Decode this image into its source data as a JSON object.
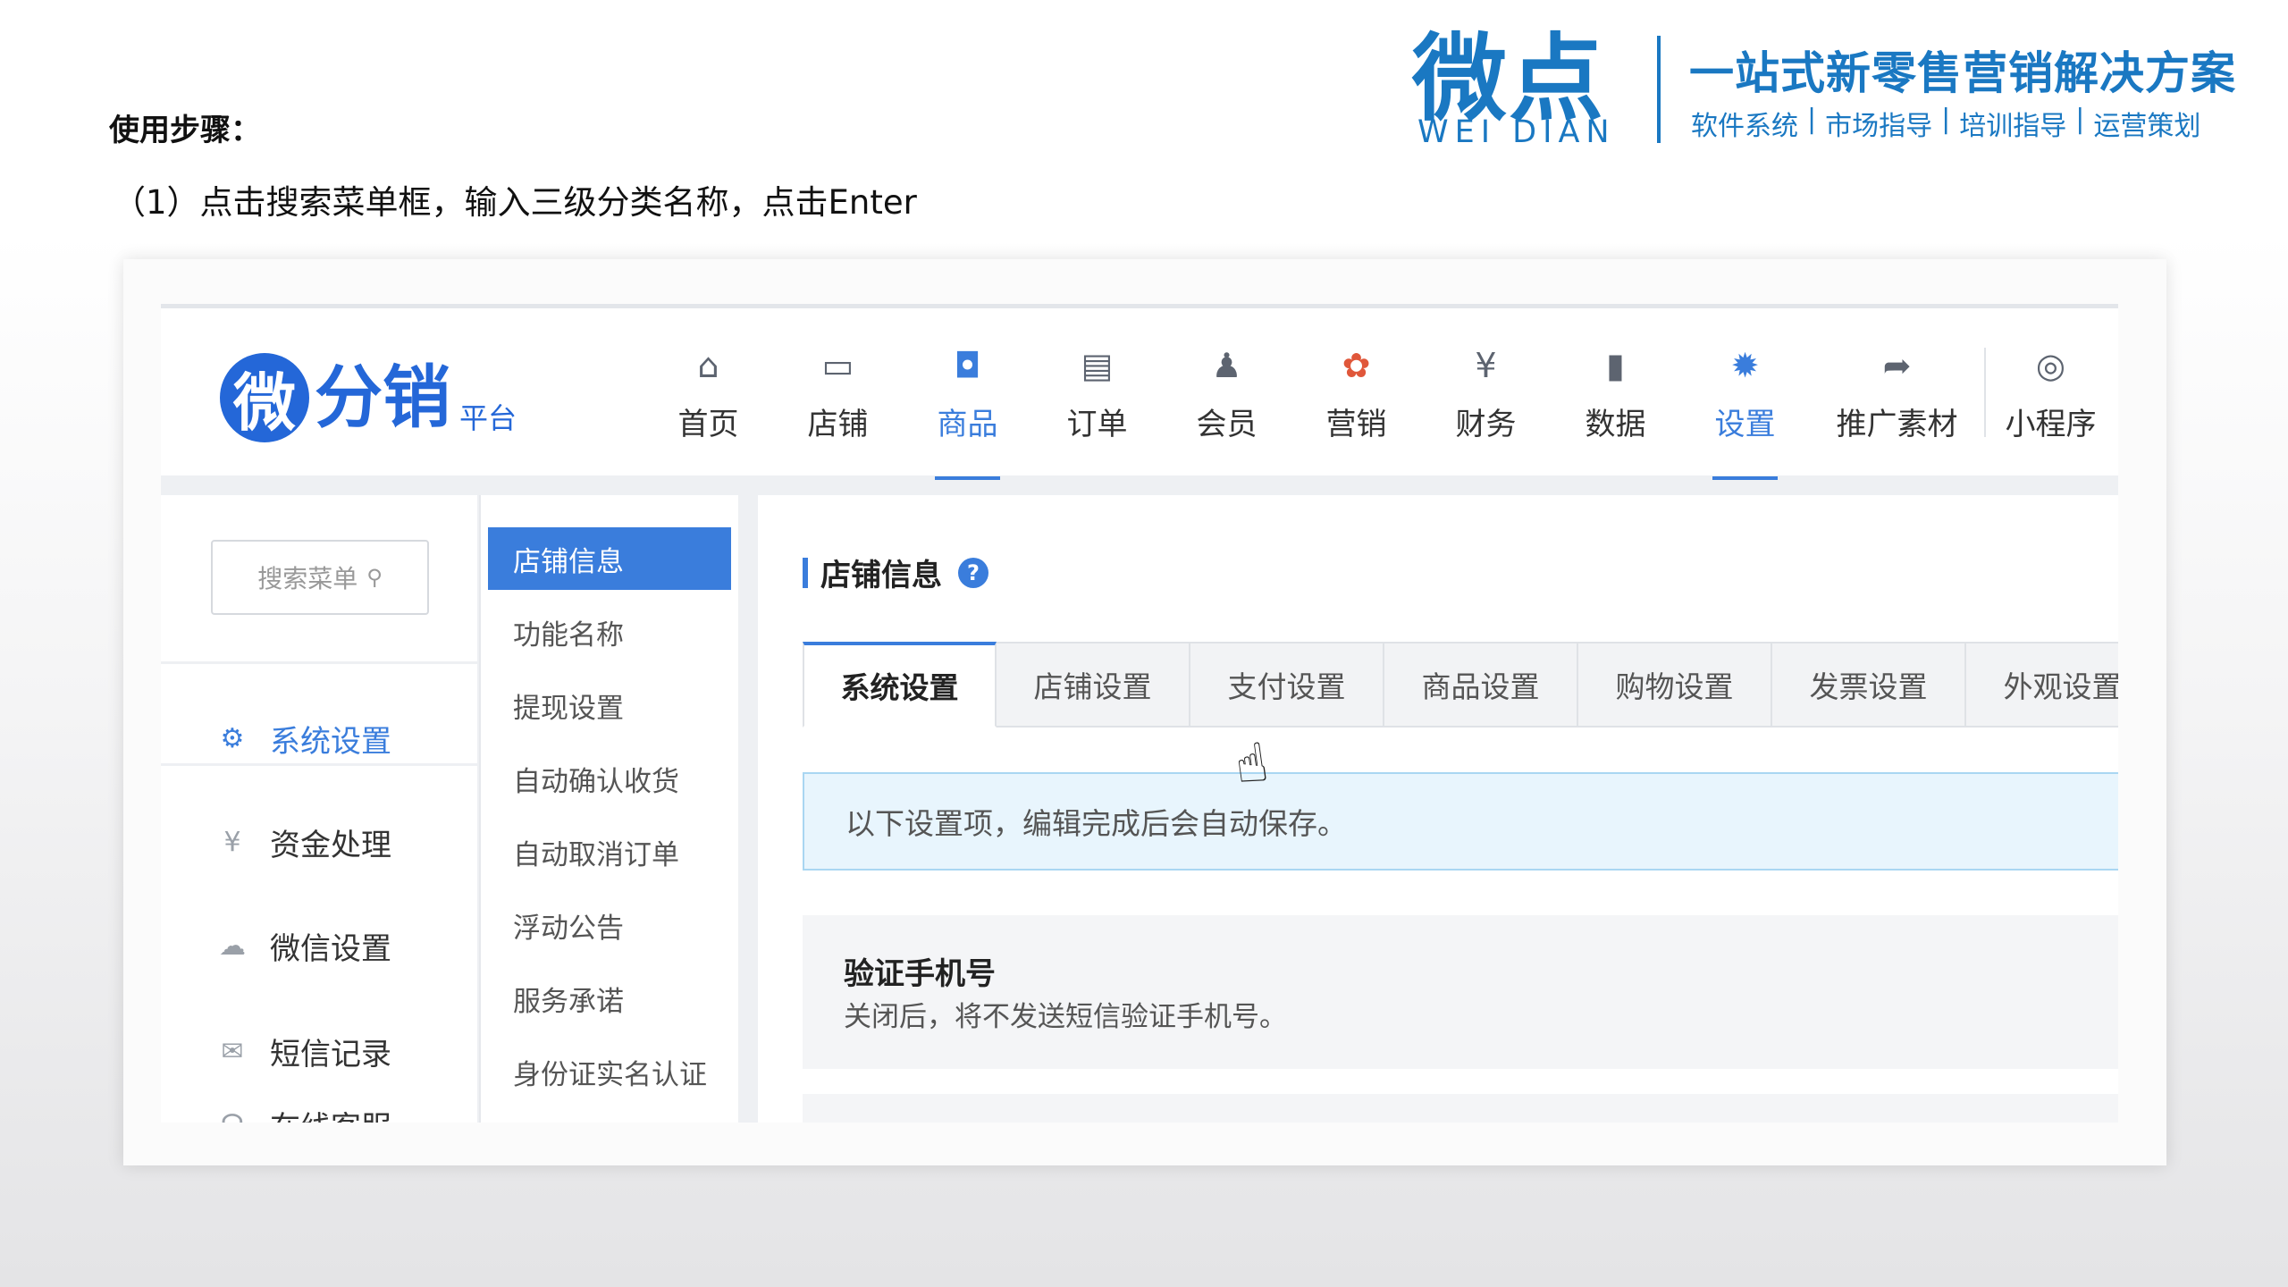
{
  "slide": {
    "steps_title": "使用步骤：",
    "step_1": "（1）点击搜索菜单框，输入三级分类名称，点击Enter"
  },
  "brand": {
    "logo_text": "微点",
    "pinyin": "WEI DIAN",
    "slogan": "一站式新零售营销解决方案",
    "services": [
      "软件系统",
      "市场指导",
      "培训指导",
      "运营策划"
    ]
  },
  "app": {
    "logo": {
      "badge": "微",
      "name": "分销",
      "sub": "平台"
    },
    "nav": [
      {
        "label": "首页",
        "icon": "home-icon",
        "glyph": "⌂"
      },
      {
        "label": "店铺",
        "icon": "store-icon",
        "glyph": "▭"
      },
      {
        "label": "商品",
        "icon": "product-icon",
        "glyph": "◘",
        "active": true
      },
      {
        "label": "订单",
        "icon": "order-icon",
        "glyph": "▤"
      },
      {
        "label": "会员",
        "icon": "member-icon",
        "glyph": "♟"
      },
      {
        "label": "营销",
        "icon": "marketing-icon",
        "glyph": "✿"
      },
      {
        "label": "财务",
        "icon": "finance-icon",
        "glyph": "¥"
      },
      {
        "label": "数据",
        "icon": "data-icon",
        "glyph": "▮"
      },
      {
        "label": "设置",
        "icon": "settings-icon",
        "glyph": "✹",
        "active": true
      },
      {
        "label": "推广素材",
        "icon": "share-icon",
        "glyph": "➦"
      },
      {
        "label": "小程序",
        "icon": "mini-program-icon",
        "glyph": "◎"
      }
    ],
    "sidebar": {
      "search_placeholder": "搜索菜单",
      "items": [
        {
          "label": "系统设置",
          "icon": "gear-icon",
          "glyph": "⚙",
          "active": true
        },
        {
          "label": "资金处理",
          "icon": "yen-icon",
          "glyph": "¥"
        },
        {
          "label": "微信设置",
          "icon": "wechat-icon",
          "glyph": "☁"
        },
        {
          "label": "短信记录",
          "icon": "mail-icon",
          "glyph": "✉"
        },
        {
          "label": "在线客服",
          "icon": "headset-icon",
          "glyph": "☊"
        }
      ]
    },
    "subnav": [
      "店铺信息",
      "功能名称",
      "提现设置",
      "自动确认收货",
      "自动取消订单",
      "浮动公告",
      "服务承诺",
      "身份证实名认证"
    ],
    "content": {
      "title": "店铺信息",
      "help": "?",
      "tabs": [
        "系统设置",
        "店铺设置",
        "支付设置",
        "商品设置",
        "购物设置",
        "发票设置",
        "外观设置"
      ],
      "notice": "以下设置项，编辑完成后会自动保存。",
      "settings": [
        {
          "title": "验证手机号",
          "desc": "关闭后，将不发送短信验证手机号。"
        }
      ]
    }
  },
  "colors": {
    "brand_blue": "#1a78c2",
    "accent": "#3a7ddc",
    "notice_bg": "#e8f5fd"
  }
}
